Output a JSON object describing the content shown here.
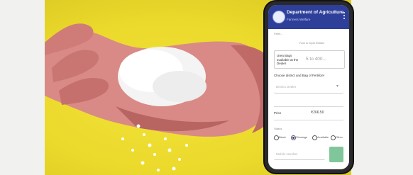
{
  "app": {
    "title": "Department of Agriculture",
    "subtitle": "Farmers Welfare"
  },
  "form": {
    "top_hint": "Farm...",
    "top_right_hint": "Form to report fertilizer",
    "field1_label": "Urea Bags available at the Dealer",
    "field1_value": "5 to 400...",
    "dropdown_label": "Choose district and Bag of Fertilizer",
    "dropdown_value": "District Dealer",
    "price_label": "Price",
    "price_value": "₹266.50",
    "radio_caption": "Status",
    "radio_options": [
      "Black",
      "Shortage",
      "Available",
      "Other"
    ],
    "selected_option": "Shortage",
    "bottom_field": "Mobile Number"
  },
  "colors": {
    "brand": "#2e3f9a",
    "background_photo": "#ebd92b",
    "submit": "#7fc79a"
  }
}
